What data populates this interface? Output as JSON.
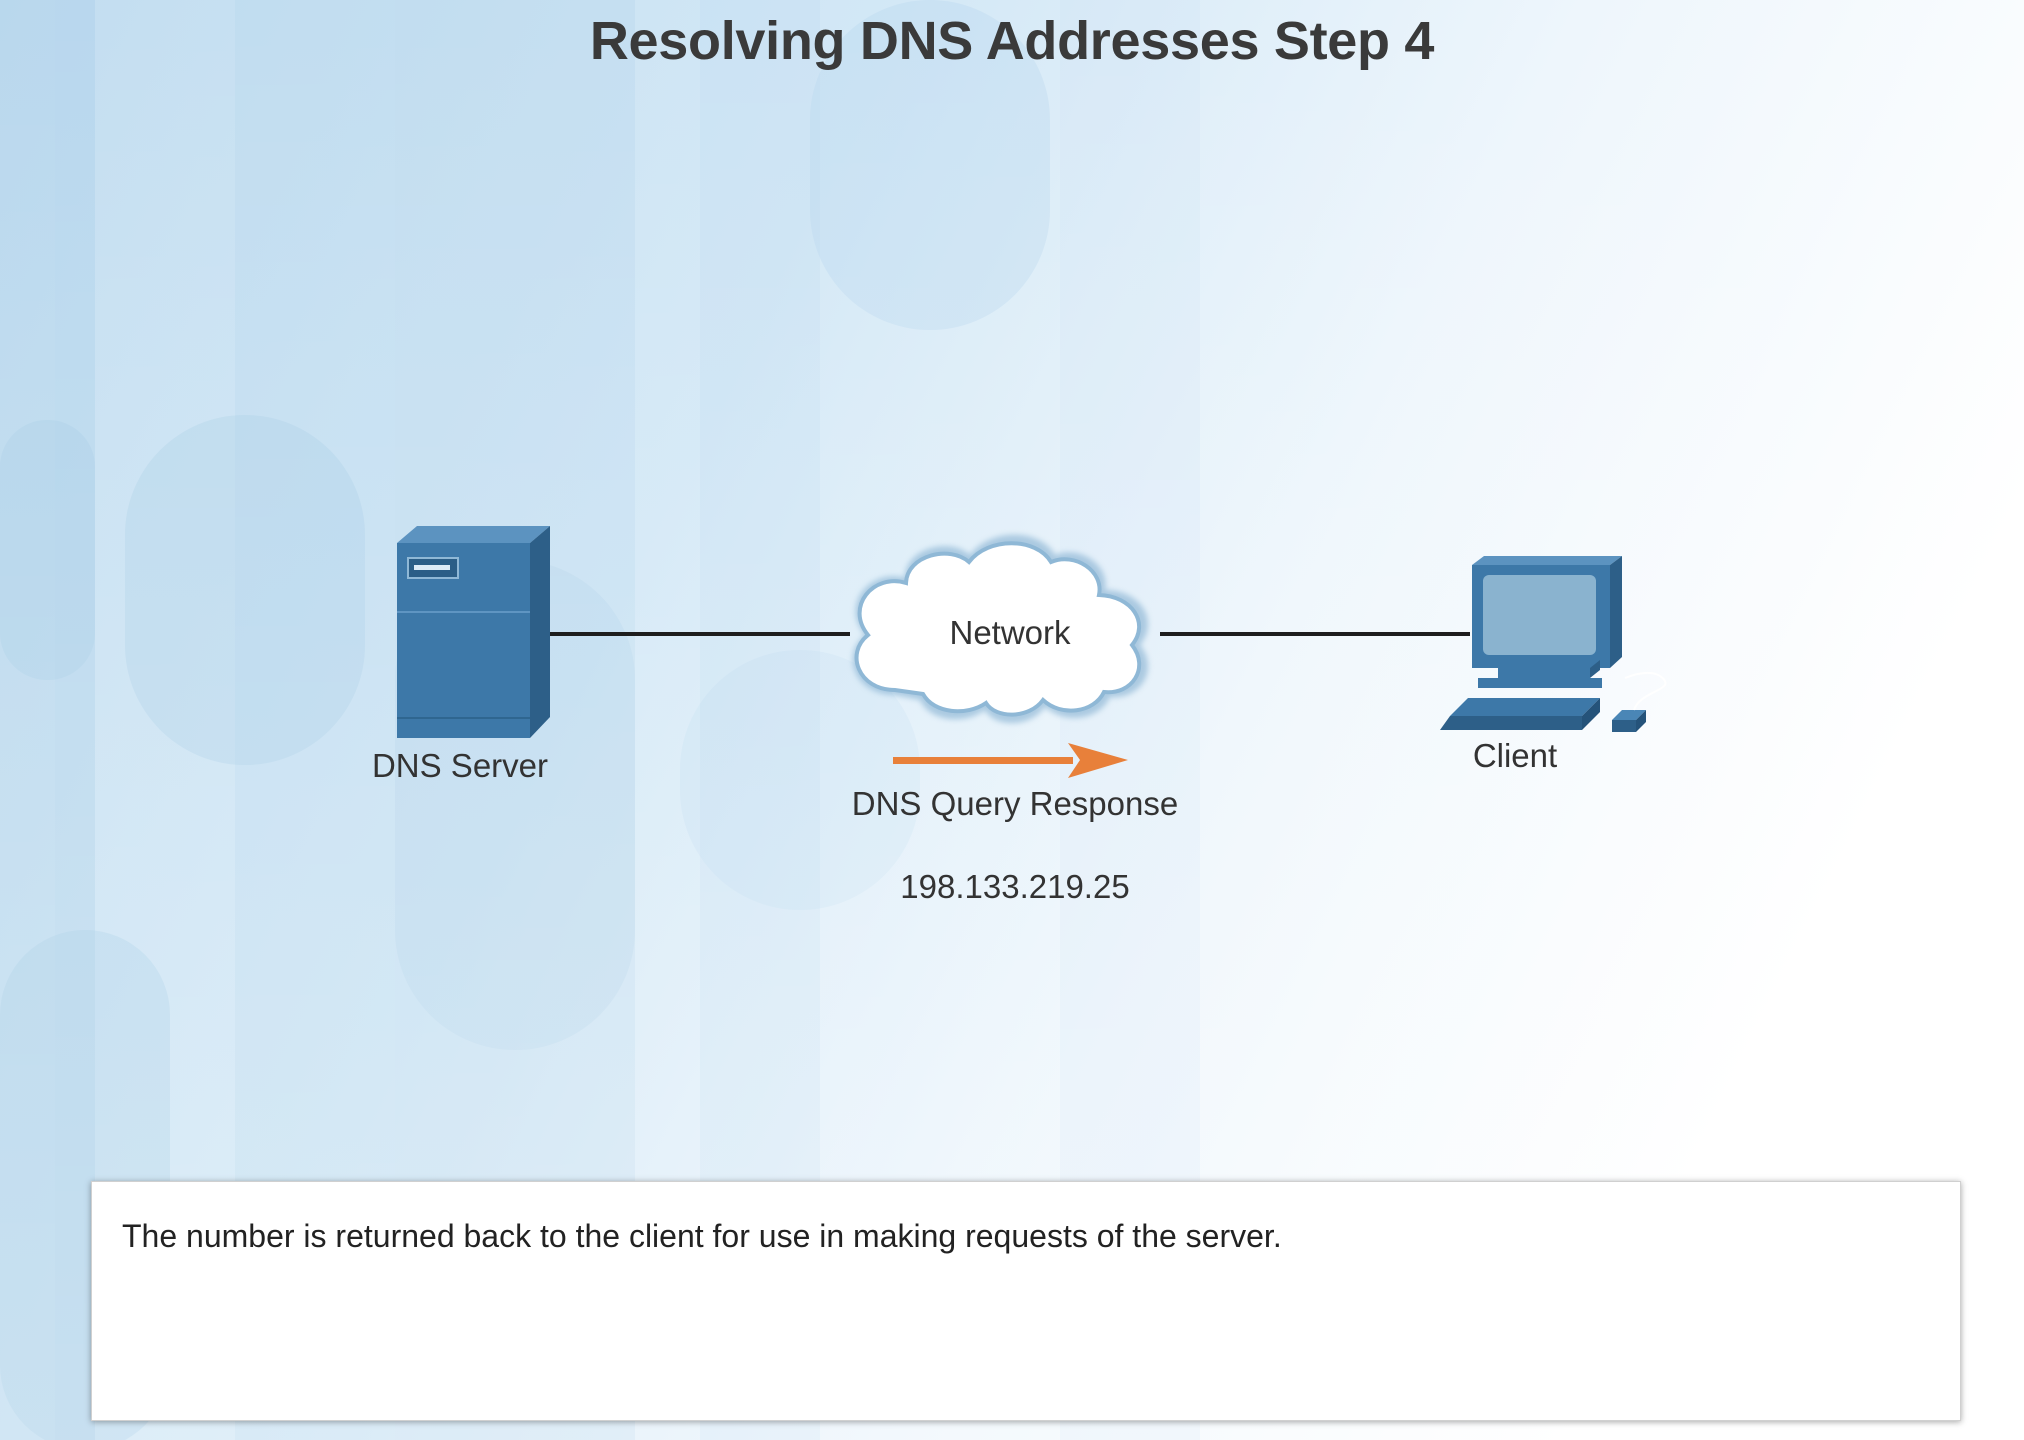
{
  "title": "Resolving DNS Addresses Step 4",
  "nodes": {
    "server": {
      "label": "DNS Server",
      "icon": "server-icon"
    },
    "network": {
      "label": "Network",
      "icon": "cloud-icon"
    },
    "client": {
      "label": "Client",
      "icon": "desktop-computer-icon"
    }
  },
  "flow": {
    "label": "DNS Query Response",
    "value": "198.133.219.25",
    "direction": "server-to-client",
    "arrow_color": "#e8803a",
    "icon": "arrow-right-icon"
  },
  "description": "The number is returned back to the client for use in making requests of the server.",
  "colors": {
    "device": "#3d78a8",
    "device_dark": "#2d5f88",
    "cloud_outline": "#8fb8d6",
    "background": "#cfe5f4"
  }
}
